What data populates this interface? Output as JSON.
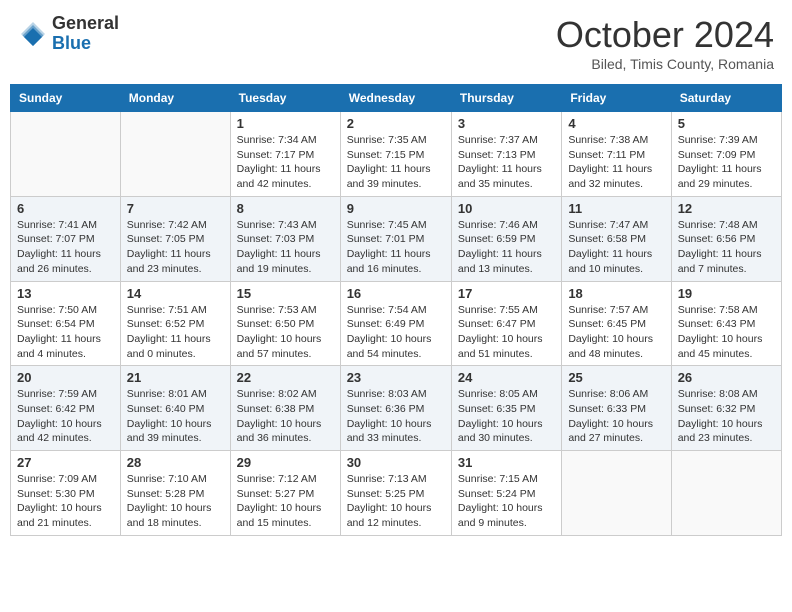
{
  "header": {
    "logo_general": "General",
    "logo_blue": "Blue",
    "month_title": "October 2024",
    "location": "Biled, Timis County, Romania"
  },
  "days_of_week": [
    "Sunday",
    "Monday",
    "Tuesday",
    "Wednesday",
    "Thursday",
    "Friday",
    "Saturday"
  ],
  "weeks": [
    [
      {
        "day": "",
        "sunrise": "",
        "sunset": "",
        "daylight": ""
      },
      {
        "day": "",
        "sunrise": "",
        "sunset": "",
        "daylight": ""
      },
      {
        "day": "1",
        "sunrise": "Sunrise: 7:34 AM",
        "sunset": "Sunset: 7:17 PM",
        "daylight": "Daylight: 11 hours and 42 minutes."
      },
      {
        "day": "2",
        "sunrise": "Sunrise: 7:35 AM",
        "sunset": "Sunset: 7:15 PM",
        "daylight": "Daylight: 11 hours and 39 minutes."
      },
      {
        "day": "3",
        "sunrise": "Sunrise: 7:37 AM",
        "sunset": "Sunset: 7:13 PM",
        "daylight": "Daylight: 11 hours and 35 minutes."
      },
      {
        "day": "4",
        "sunrise": "Sunrise: 7:38 AM",
        "sunset": "Sunset: 7:11 PM",
        "daylight": "Daylight: 11 hours and 32 minutes."
      },
      {
        "day": "5",
        "sunrise": "Sunrise: 7:39 AM",
        "sunset": "Sunset: 7:09 PM",
        "daylight": "Daylight: 11 hours and 29 minutes."
      }
    ],
    [
      {
        "day": "6",
        "sunrise": "Sunrise: 7:41 AM",
        "sunset": "Sunset: 7:07 PM",
        "daylight": "Daylight: 11 hours and 26 minutes."
      },
      {
        "day": "7",
        "sunrise": "Sunrise: 7:42 AM",
        "sunset": "Sunset: 7:05 PM",
        "daylight": "Daylight: 11 hours and 23 minutes."
      },
      {
        "day": "8",
        "sunrise": "Sunrise: 7:43 AM",
        "sunset": "Sunset: 7:03 PM",
        "daylight": "Daylight: 11 hours and 19 minutes."
      },
      {
        "day": "9",
        "sunrise": "Sunrise: 7:45 AM",
        "sunset": "Sunset: 7:01 PM",
        "daylight": "Daylight: 11 hours and 16 minutes."
      },
      {
        "day": "10",
        "sunrise": "Sunrise: 7:46 AM",
        "sunset": "Sunset: 6:59 PM",
        "daylight": "Daylight: 11 hours and 13 minutes."
      },
      {
        "day": "11",
        "sunrise": "Sunrise: 7:47 AM",
        "sunset": "Sunset: 6:58 PM",
        "daylight": "Daylight: 11 hours and 10 minutes."
      },
      {
        "day": "12",
        "sunrise": "Sunrise: 7:48 AM",
        "sunset": "Sunset: 6:56 PM",
        "daylight": "Daylight: 11 hours and 7 minutes."
      }
    ],
    [
      {
        "day": "13",
        "sunrise": "Sunrise: 7:50 AM",
        "sunset": "Sunset: 6:54 PM",
        "daylight": "Daylight: 11 hours and 4 minutes."
      },
      {
        "day": "14",
        "sunrise": "Sunrise: 7:51 AM",
        "sunset": "Sunset: 6:52 PM",
        "daylight": "Daylight: 11 hours and 0 minutes."
      },
      {
        "day": "15",
        "sunrise": "Sunrise: 7:53 AM",
        "sunset": "Sunset: 6:50 PM",
        "daylight": "Daylight: 10 hours and 57 minutes."
      },
      {
        "day": "16",
        "sunrise": "Sunrise: 7:54 AM",
        "sunset": "Sunset: 6:49 PM",
        "daylight": "Daylight: 10 hours and 54 minutes."
      },
      {
        "day": "17",
        "sunrise": "Sunrise: 7:55 AM",
        "sunset": "Sunset: 6:47 PM",
        "daylight": "Daylight: 10 hours and 51 minutes."
      },
      {
        "day": "18",
        "sunrise": "Sunrise: 7:57 AM",
        "sunset": "Sunset: 6:45 PM",
        "daylight": "Daylight: 10 hours and 48 minutes."
      },
      {
        "day": "19",
        "sunrise": "Sunrise: 7:58 AM",
        "sunset": "Sunset: 6:43 PM",
        "daylight": "Daylight: 10 hours and 45 minutes."
      }
    ],
    [
      {
        "day": "20",
        "sunrise": "Sunrise: 7:59 AM",
        "sunset": "Sunset: 6:42 PM",
        "daylight": "Daylight: 10 hours and 42 minutes."
      },
      {
        "day": "21",
        "sunrise": "Sunrise: 8:01 AM",
        "sunset": "Sunset: 6:40 PM",
        "daylight": "Daylight: 10 hours and 39 minutes."
      },
      {
        "day": "22",
        "sunrise": "Sunrise: 8:02 AM",
        "sunset": "Sunset: 6:38 PM",
        "daylight": "Daylight: 10 hours and 36 minutes."
      },
      {
        "day": "23",
        "sunrise": "Sunrise: 8:03 AM",
        "sunset": "Sunset: 6:36 PM",
        "daylight": "Daylight: 10 hours and 33 minutes."
      },
      {
        "day": "24",
        "sunrise": "Sunrise: 8:05 AM",
        "sunset": "Sunset: 6:35 PM",
        "daylight": "Daylight: 10 hours and 30 minutes."
      },
      {
        "day": "25",
        "sunrise": "Sunrise: 8:06 AM",
        "sunset": "Sunset: 6:33 PM",
        "daylight": "Daylight: 10 hours and 27 minutes."
      },
      {
        "day": "26",
        "sunrise": "Sunrise: 8:08 AM",
        "sunset": "Sunset: 6:32 PM",
        "daylight": "Daylight: 10 hours and 23 minutes."
      }
    ],
    [
      {
        "day": "27",
        "sunrise": "Sunrise: 7:09 AM",
        "sunset": "Sunset: 5:30 PM",
        "daylight": "Daylight: 10 hours and 21 minutes."
      },
      {
        "day": "28",
        "sunrise": "Sunrise: 7:10 AM",
        "sunset": "Sunset: 5:28 PM",
        "daylight": "Daylight: 10 hours and 18 minutes."
      },
      {
        "day": "29",
        "sunrise": "Sunrise: 7:12 AM",
        "sunset": "Sunset: 5:27 PM",
        "daylight": "Daylight: 10 hours and 15 minutes."
      },
      {
        "day": "30",
        "sunrise": "Sunrise: 7:13 AM",
        "sunset": "Sunset: 5:25 PM",
        "daylight": "Daylight: 10 hours and 12 minutes."
      },
      {
        "day": "31",
        "sunrise": "Sunrise: 7:15 AM",
        "sunset": "Sunset: 5:24 PM",
        "daylight": "Daylight: 10 hours and 9 minutes."
      },
      {
        "day": "",
        "sunrise": "",
        "sunset": "",
        "daylight": ""
      },
      {
        "day": "",
        "sunrise": "",
        "sunset": "",
        "daylight": ""
      }
    ]
  ]
}
